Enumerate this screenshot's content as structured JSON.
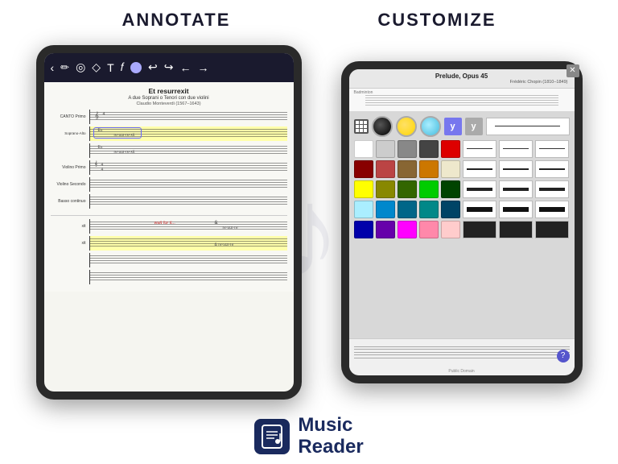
{
  "header": {
    "annotate_label": "ANNOTATE",
    "customize_label": "CUSTOMIZE"
  },
  "left_tablet": {
    "music_title": "Et resurrexit",
    "music_subtitle": "A due Soprani o Tenori con due violini",
    "music_composer": "Claudio Monteverdi (1567–1643)",
    "parts": [
      {
        "label": "CANTO Primo"
      },
      {
        "label": "Soprano-Alto",
        "highlighted": true
      },
      {
        "label": ""
      },
      {
        "label": "Violino Primo"
      },
      {
        "label": "Violino Secondo"
      },
      {
        "label": "Basso continuo"
      }
    ],
    "wait_text": "wait for it...",
    "bottom_parts": [
      {
        "label": "xii"
      },
      {
        "label": "",
        "highlighted": true
      },
      {
        "label": "xii"
      },
      {
        "label": ""
      },
      {
        "label": ""
      }
    ]
  },
  "right_tablet": {
    "prelude_title": "Prelude, Opus 45",
    "prelude_composer": "Frédéric Chopin (1810–1849)",
    "badminton_label": "Badminton",
    "colors": {
      "row1_special": [
        "#000000",
        "#FFD700",
        "#44BBDD"
      ],
      "row2": [
        "#FFFFFF",
        "#BBBBBB",
        "#666666",
        "#333333",
        "#CC0000"
      ],
      "row3": [
        "#880000",
        "#AA3333",
        "#886633",
        "#CC6600",
        "#EEEECC"
      ],
      "row4": [
        "#FFFF00",
        "#888800",
        "#338800",
        "#00CC00",
        "#006600"
      ],
      "row5": [
        "#AAEEFF",
        "#0088CC",
        "#006688",
        "#008888",
        "#004466"
      ],
      "row6": [
        "#0000AA",
        "#6600AA",
        "#FF00FF",
        "#FF88AA",
        "#FFCCCC"
      ]
    },
    "line_weights": [
      "thin",
      "medium",
      "thick",
      "thickest"
    ],
    "public_domain": "Public Domain",
    "help_label": "?"
  },
  "footer": {
    "app_name_line1": "Music",
    "app_name_line2": "Reader"
  }
}
